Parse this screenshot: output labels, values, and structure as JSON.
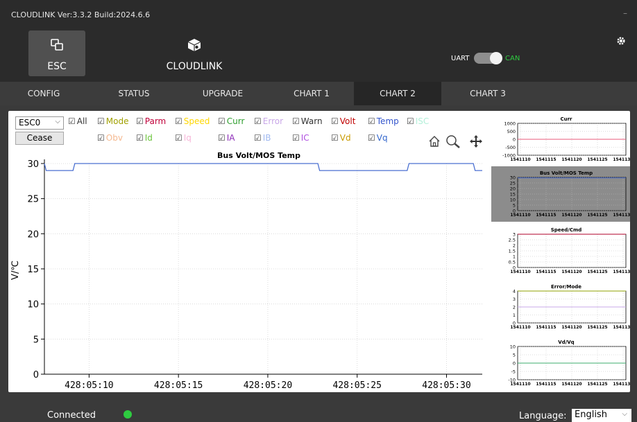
{
  "window": {
    "title": "CLOUDLINK   Ver:3.3.2  Build:2024.6.6",
    "minimize_label": "–"
  },
  "header": {
    "apps": [
      {
        "label": "ESC",
        "icon": "esc-icon",
        "active": true
      },
      {
        "label": "CLOUDLINK",
        "icon": "cloudlink-box-icon",
        "active": false
      }
    ],
    "interface_toggle": {
      "left_label": "UART",
      "right_label": "CAN",
      "selected": "CAN"
    },
    "settings_icon": "gear-icon"
  },
  "tabs": [
    {
      "label": "CONFIG"
    },
    {
      "label": "STATUS"
    },
    {
      "label": "UPGRADE"
    },
    {
      "label": "CHART 1"
    },
    {
      "label": "CHART 2",
      "active": true
    },
    {
      "label": "CHART 3"
    }
  ],
  "controls": {
    "esc_select": "ESC0",
    "cease_label": "Cease",
    "checkboxes_row1": [
      {
        "label": "All",
        "color": "#333333"
      },
      {
        "label": "Mode",
        "color": "#a0a000"
      },
      {
        "label": "Parm",
        "color": "#c0003a"
      },
      {
        "label": "Speed",
        "color": "#ffd700"
      },
      {
        "label": "Curr",
        "color": "#2e9e2e"
      },
      {
        "label": "Error",
        "color": "#c9a7e8"
      },
      {
        "label": "Warn",
        "color": "#333333"
      },
      {
        "label": "Volt",
        "color": "#c00000"
      },
      {
        "label": "Temp",
        "color": "#3355cc"
      },
      {
        "label": "ISC",
        "color": "#b2f0d9"
      }
    ],
    "checkboxes_row2": [
      {
        "label": "Obv",
        "color": "#f5b990"
      },
      {
        "label": "Id",
        "color": "#6cc43d"
      },
      {
        "label": "Iq",
        "color": "#f7b6d8"
      },
      {
        "label": "IA",
        "color": "#8d2bb8"
      },
      {
        "label": "IB",
        "color": "#9fb8f0"
      },
      {
        "label": "IC",
        "color": "#b04fe0"
      },
      {
        "label": "Vd",
        "color": "#c89a00"
      },
      {
        "label": "Vq",
        "color": "#3366cc"
      }
    ],
    "toolbar_icons": [
      "home-icon",
      "zoom-icon",
      "pan-icon"
    ]
  },
  "chart_data": [
    {
      "type": "line",
      "title": "Bus Volt/MOS Temp",
      "ylabel": "V/℃",
      "xlabel": "",
      "ylim": [
        0,
        30
      ],
      "yticks": [
        0,
        5,
        10,
        15,
        20,
        25,
        30
      ],
      "xticks": [
        "428:05:10",
        "428:05:15",
        "428:05:20",
        "428:05:25",
        "428:05:30"
      ],
      "x_seconds_range": [
        7.5,
        32.0
      ],
      "series": [
        {
          "color": "#4a6fd1",
          "x": [
            7.5,
            7.6,
            9.1,
            9.2,
            22.8,
            22.9,
            27.8,
            27.9,
            31.5,
            31.6,
            32.0
          ],
          "y": [
            30,
            29,
            29,
            30,
            30,
            29,
            29,
            30,
            30,
            29,
            29
          ]
        }
      ]
    },
    {
      "type": "line",
      "title": "Curr",
      "yticks": [
        "1000",
        "500",
        "0",
        "-500",
        "-1000"
      ],
      "ylim": [
        -1000,
        1000
      ],
      "xticks": [
        "1541110",
        "1541115",
        "1541120",
        "1541125",
        "1541130"
      ],
      "series": [
        {
          "color": "#e85a7a",
          "y": [
            0,
            0
          ]
        }
      ]
    },
    {
      "type": "line",
      "title": "Bus Volt/MOS Temp",
      "yticks": [
        "30",
        "25",
        "20",
        "15",
        "10",
        "5",
        "0"
      ],
      "ylim": [
        0,
        30
      ],
      "xticks": [
        "1541110",
        "1541115",
        "1541120",
        "1541125",
        "1541130"
      ],
      "series": [
        {
          "color": "#4a6fd1",
          "y": [
            29.5,
            29.5
          ]
        }
      ],
      "selected": true
    },
    {
      "type": "line",
      "title": "Speed/Cmd",
      "yticks": [
        "3",
        "2.5",
        "2",
        "1.5",
        "1",
        "0.5",
        "0"
      ],
      "ylim": [
        0,
        3
      ],
      "xticks": [
        "1541110",
        "1541115",
        "1541120",
        "1541125",
        "1541130"
      ],
      "series": [
        {
          "color": "#b0002a",
          "y": [
            3,
            3
          ]
        }
      ]
    },
    {
      "type": "line",
      "title": "Error/Mode",
      "yticks": [
        "4",
        "3",
        "2",
        "1",
        "0"
      ],
      "ylim": [
        0,
        4
      ],
      "xticks": [
        "1541110",
        "1541115",
        "1541120",
        "1541125",
        "1541130"
      ],
      "series": [
        {
          "color": "#8fa000",
          "y": [
            4,
            4
          ]
        },
        {
          "color": "#c9a7e8",
          "y": [
            2,
            2
          ]
        }
      ]
    },
    {
      "type": "line",
      "title": "Vd/Vq",
      "yticks": [
        "10",
        "5",
        "0",
        "-5",
        "-10"
      ],
      "ylim": [
        -10,
        10
      ],
      "xticks": [
        "1541110",
        "1541115",
        "1541120",
        "1541125",
        "1541130"
      ],
      "series": [
        {
          "color": "#3cae6e",
          "y": [
            0,
            0
          ]
        }
      ]
    }
  ],
  "footer": {
    "status": "Connected",
    "language_label": "Language:",
    "language_value": "English"
  }
}
